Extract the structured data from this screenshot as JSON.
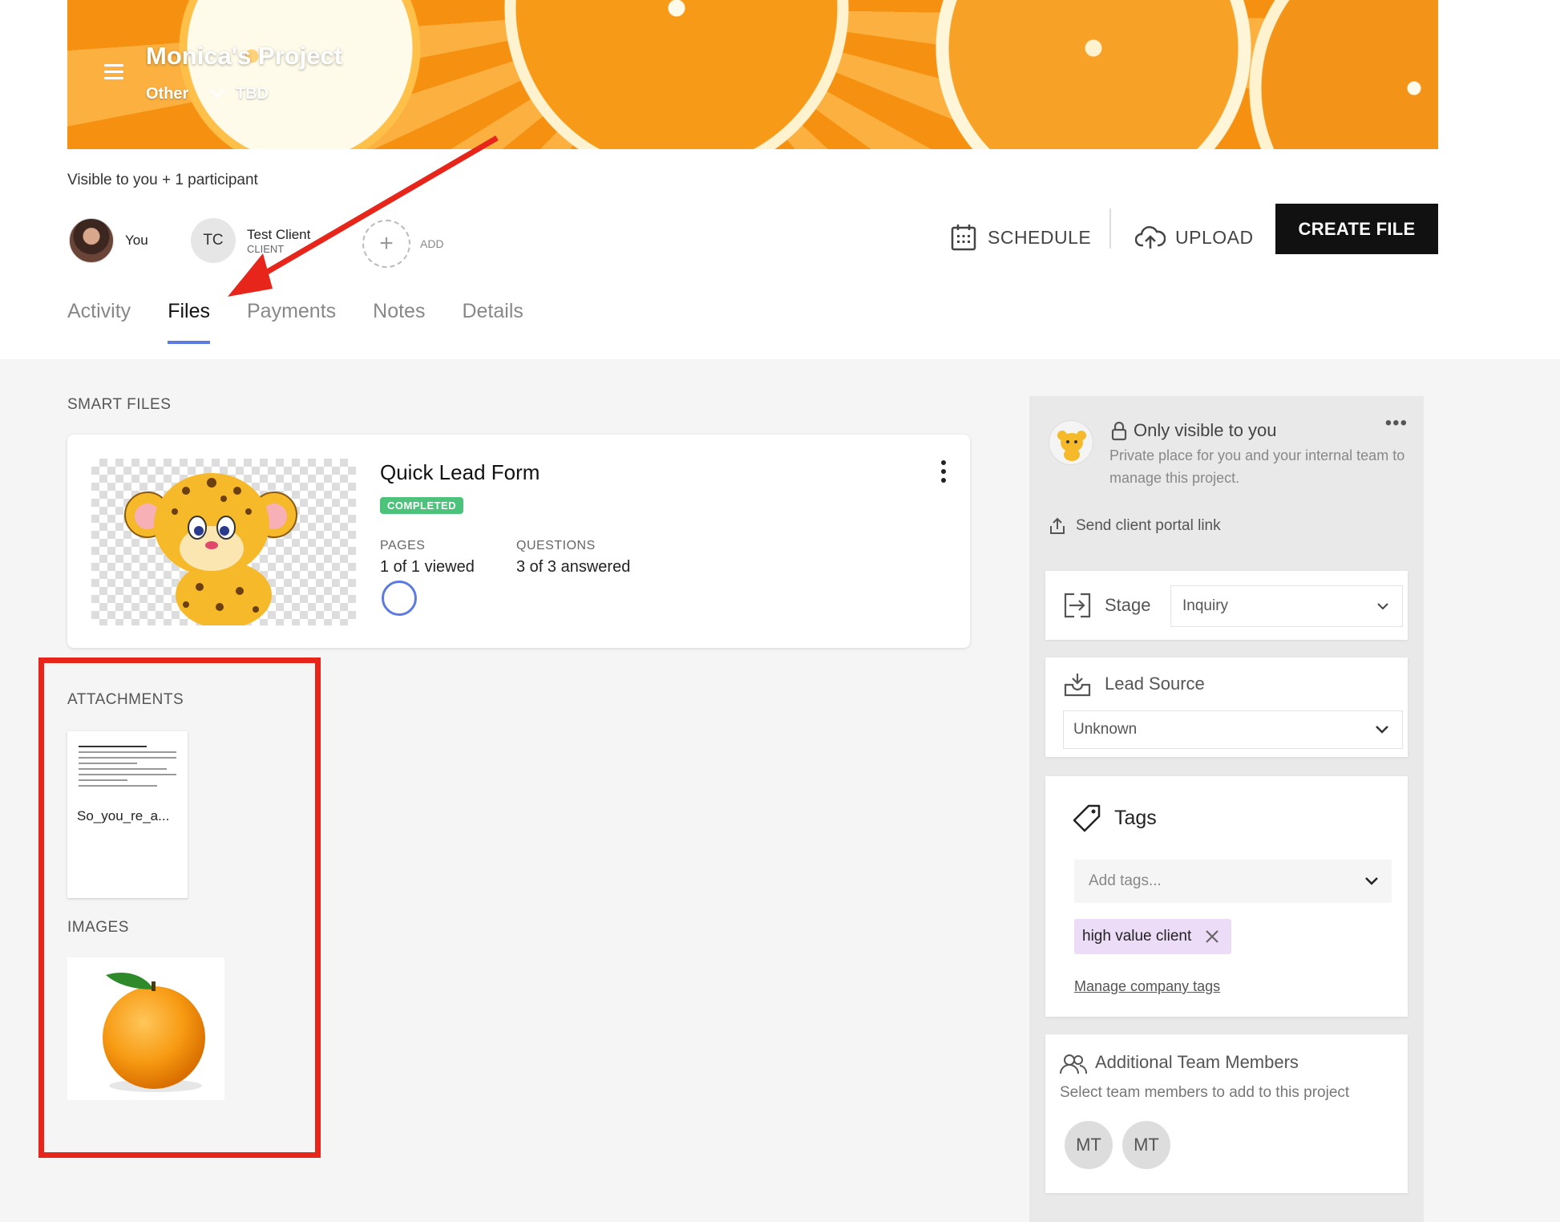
{
  "header": {
    "title": "Monica's Project",
    "type": "Other",
    "date": "TBD",
    "visibility": "Visible to you + 1 participant"
  },
  "participants": [
    {
      "name": "You",
      "sub": ""
    },
    {
      "initials": "TC",
      "name": "Test Client",
      "sub": "CLIENT"
    }
  ],
  "add_label": "ADD",
  "actions": {
    "schedule": "SCHEDULE",
    "upload": "UPLOAD",
    "create_file": "CREATE FILE"
  },
  "tabs": [
    {
      "label": "Activity",
      "active": false
    },
    {
      "label": "Files",
      "active": true
    },
    {
      "label": "Payments",
      "active": false
    },
    {
      "label": "Notes",
      "active": false
    },
    {
      "label": "Details",
      "active": false
    }
  ],
  "smart_files": {
    "section_label": "SMART FILES",
    "card": {
      "title": "Quick Lead Form",
      "status": "COMPLETED",
      "pages_label": "PAGES",
      "pages_value": "1 of 1 viewed",
      "questions_label": "QUESTIONS",
      "questions_value": "3 of 3 answered"
    }
  },
  "attachments": {
    "section_label": "ATTACHMENTS",
    "items": [
      {
        "name": "So_you_re_a..."
      }
    ]
  },
  "images": {
    "section_label": "IMAGES"
  },
  "sidebar": {
    "private_title": "Only visible to you",
    "private_desc": "Private place for you and your internal team to manage this project.",
    "portal_link": "Send client portal link",
    "stage": {
      "label": "Stage",
      "value": "Inquiry"
    },
    "lead_source": {
      "label": "Lead Source",
      "value": "Unknown"
    },
    "tags": {
      "label": "Tags",
      "placeholder": "Add tags...",
      "items": [
        "high value client"
      ],
      "manage": "Manage company tags"
    },
    "team": {
      "label": "Additional Team Members",
      "desc": "Select team members to add to this project",
      "members": [
        "MT",
        "MT"
      ]
    }
  },
  "colors": {
    "accent": "#5b7be0",
    "completed": "#4cc27a",
    "annotation": "#e8251a",
    "tag_bg": "#ecdcf7"
  }
}
